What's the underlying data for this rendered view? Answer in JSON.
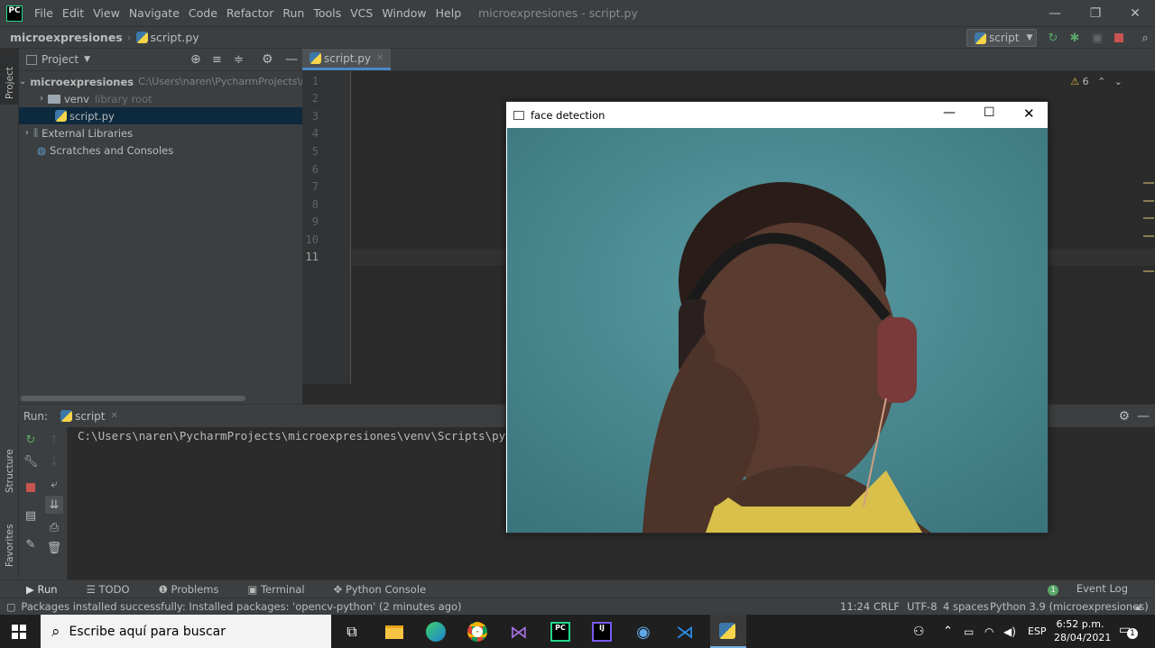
{
  "ide": {
    "app_icon": "PC",
    "menu": [
      "File",
      "Edit",
      "View",
      "Navigate",
      "Code",
      "Refactor",
      "Run",
      "Tools",
      "VCS",
      "Window",
      "Help"
    ],
    "window_title": "microexpresiones - script.py",
    "breadcrumb": {
      "project": "microexpresiones",
      "file": "script.py"
    },
    "run_config": "script",
    "left_stripe": {
      "project": "Project",
      "structure": "Structure",
      "favorites": "Favorites"
    },
    "project_panel": {
      "title": "Project",
      "root": {
        "name": "microexpresiones",
        "path": "C:\\Users\\naren\\PycharmProjects\\m"
      },
      "venv": {
        "name": "venv",
        "note": "library root"
      },
      "file": "script.py",
      "external": "External Libraries",
      "scratches": "Scratches and Consoles"
    },
    "editor": {
      "tab": "script.py",
      "warning_count": "6",
      "line_numbers": [
        "1",
        "2",
        "3",
        "4",
        "5",
        "6",
        "7",
        "8",
        "9",
        "10",
        "11"
      ]
    },
    "run_panel": {
      "label": "Run:",
      "tab": "script",
      "output": "C:\\Users\\naren\\PycharmProjects\\microexpresiones\\venv\\Scripts\\py"
    },
    "tool_windows": [
      "Run",
      "TODO",
      "Problems",
      "Terminal",
      "Python Console"
    ],
    "event_log": "Event Log",
    "status": {
      "message": "Packages installed successfully: Installed packages: 'opencv-python' (2 minutes ago)",
      "position": "11:24",
      "line_sep": "CRLF",
      "encoding": "UTF-8",
      "indent": "4 spaces",
      "interpreter": "Python 3.9 (microexpresiones)"
    }
  },
  "cv_window": {
    "title": "face detection"
  },
  "taskbar": {
    "search_placeholder": "Escribe aquí para buscar",
    "lang": "ESP",
    "time": "6:52 p.m.",
    "date": "28/04/2021",
    "notif_count": "1"
  },
  "colors": {
    "accent": "#4a88c7",
    "keyword": "#cc7832",
    "string": "#6a8759",
    "run_green": "#59a869",
    "stop_red": "#c75450"
  }
}
